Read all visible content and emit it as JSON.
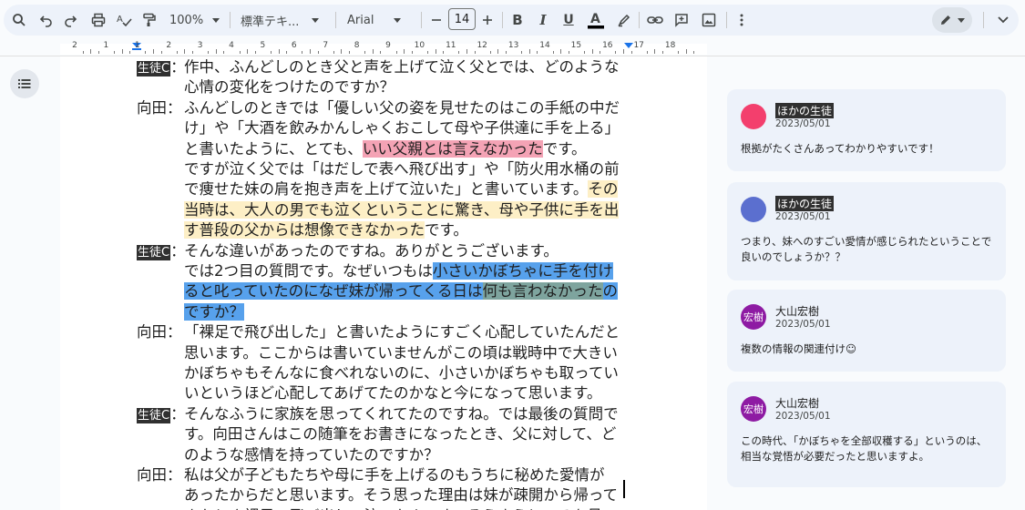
{
  "toolbar": {
    "zoom": "100%",
    "style": "標準テキ...",
    "font": "Arial",
    "font_size": "14"
  },
  "ruler": {
    "labels": [
      "2",
      "1",
      "1",
      "2",
      "3",
      "4",
      "5",
      "6",
      "7",
      "8",
      "9",
      "10",
      "11",
      "12",
      "13",
      "14",
      "15",
      "16",
      "17",
      "18"
    ]
  },
  "document": {
    "lines": [
      {
        "speaker": "生徒C",
        "boxed": true,
        "segments": [
          {
            "t": "作中、ふんどしのとき父と声を上げて泣く父とでは、どのような",
            "h": ""
          }
        ]
      },
      {
        "speaker": "",
        "boxed": false,
        "segments": [
          {
            "t": "心情の変化をつけたのですか？",
            "h": ""
          }
        ]
      },
      {
        "speaker": "向田：",
        "boxed": false,
        "segments": [
          {
            "t": "ふんどしのときでは「優しい父の姿を見せたのはこの手紙の中だ",
            "h": ""
          }
        ]
      },
      {
        "speaker": "",
        "boxed": false,
        "segments": [
          {
            "t": "け」や「大酒を飲みかんしゃくおこして母や子供達に手を上る」",
            "h": ""
          }
        ]
      },
      {
        "speaker": "",
        "boxed": false,
        "segments": [
          {
            "t": "と書いたように、とても、",
            "h": ""
          },
          {
            "t": "いい父親とは言えなかった",
            "h": "pink"
          },
          {
            "t": "です。",
            "h": ""
          }
        ]
      },
      {
        "speaker": "",
        "boxed": false,
        "segments": [
          {
            "t": "ですが泣く父では「はだしで表へ飛び出す」や「防火用水桶の前",
            "h": ""
          }
        ]
      },
      {
        "speaker": "",
        "boxed": false,
        "segments": [
          {
            "t": "で痩せた妹の肩を抱き声を上げて泣いた」と書いています。",
            "h": ""
          },
          {
            "t": "その",
            "h": "yellow"
          }
        ]
      },
      {
        "speaker": "",
        "boxed": false,
        "segments": [
          {
            "t": "当時は、大人の男でも泣くということに驚き、母や子供に手を出",
            "h": "yellow"
          }
        ]
      },
      {
        "speaker": "",
        "boxed": false,
        "segments": [
          {
            "t": "す普段の父からは想像できなかった",
            "h": "yellow"
          },
          {
            "t": "です。",
            "h": ""
          }
        ]
      },
      {
        "speaker": "生徒C",
        "boxed": true,
        "segments": [
          {
            "t": "そんな違いがあったのですね。ありがとうございます。",
            "h": ""
          }
        ]
      },
      {
        "speaker": "",
        "boxed": false,
        "segments": [
          {
            "t": "では2つ目の質問です。なぜいつもは",
            "h": ""
          },
          {
            "t": "小さいかぼちゃに手を付け",
            "h": "blue"
          }
        ]
      },
      {
        "speaker": "",
        "boxed": false,
        "segments": [
          {
            "t": "ると叱っていたのになぜ妹が帰ってくる日は",
            "h": "blue"
          },
          {
            "t": "何も言わなかった",
            "h": "bluedark"
          },
          {
            "t": "の",
            "h": "blue"
          }
        ]
      },
      {
        "speaker": "",
        "boxed": false,
        "segments": [
          {
            "t": "ですか？",
            "h": "blue"
          }
        ]
      },
      {
        "speaker": "向田：",
        "boxed": false,
        "segments": [
          {
            "t": "「裸足で飛び出した」と書いたようにすごく心配していたんだと",
            "h": ""
          }
        ]
      },
      {
        "speaker": "",
        "boxed": false,
        "segments": [
          {
            "t": "思います。ここからは書いていませんがこの頃は戦時中で大きい",
            "h": ""
          }
        ]
      },
      {
        "speaker": "",
        "boxed": false,
        "segments": [
          {
            "t": "かぼちゃもそんなに食べれないのに、小さいかぼちゃも取ってい",
            "h": ""
          }
        ]
      },
      {
        "speaker": "",
        "boxed": false,
        "segments": [
          {
            "t": "いというほど心配してあげてたのかなと今になって思います。",
            "h": ""
          }
        ]
      },
      {
        "speaker": "生徒C",
        "boxed": true,
        "segments": [
          {
            "t": "そんなふうに家族を思ってくれてたのですね。では最後の質問で",
            "h": ""
          }
        ]
      },
      {
        "speaker": "",
        "boxed": false,
        "segments": [
          {
            "t": "す。向田さんはこの随筆をお書きになったとき、父に対して、ど",
            "h": ""
          }
        ]
      },
      {
        "speaker": "",
        "boxed": false,
        "segments": [
          {
            "t": "のような感情を持っていたのですか？",
            "h": ""
          }
        ]
      },
      {
        "speaker": "向田：",
        "boxed": false,
        "segments": [
          {
            "t": "私は父が子どもたちや母に手を上げるのもうちに秘めた愛情が",
            "h": ""
          }
        ]
      },
      {
        "speaker": "",
        "boxed": false,
        "segments": [
          {
            "t": "あったからだと思います。そう思った理由は妹が疎開から帰って",
            "h": ""
          }
        ]
      },
      {
        "speaker": "",
        "boxed": false,
        "segments": [
          {
            "t": "きたとき裸足で飛び出して泣いたんです。そうゆうところを見て",
            "h": ""
          }
        ]
      }
    ]
  },
  "comments": [
    {
      "author": "ほかの生徒",
      "date": "2023/05/01",
      "text": "根拠がたくさんあってわかりやすいです！",
      "avatar_color": "#f33f6d",
      "avatar_text": ""
    },
    {
      "author": "ほかの生徒",
      "date": "2023/05/01",
      "text": "つまり、妹へのすごい愛情が感じられたということで良いのでしょうか？？",
      "avatar_color": "#5b6fcf",
      "avatar_text": ""
    },
    {
      "author": "大山宏樹",
      "date": "2023/05/01",
      "text": "複数の情報の関連付け☺",
      "avatar_color": "#8e1ba3",
      "avatar_text": "宏樹"
    },
    {
      "author": "大山宏樹",
      "date": "2023/05/01",
      "text": "この時代、「かぼちゃを全部収穫する」というのは、相当な覚悟が必要だったと思いますよ。",
      "avatar_color": "#8e1ba3",
      "avatar_text": "宏樹"
    }
  ]
}
